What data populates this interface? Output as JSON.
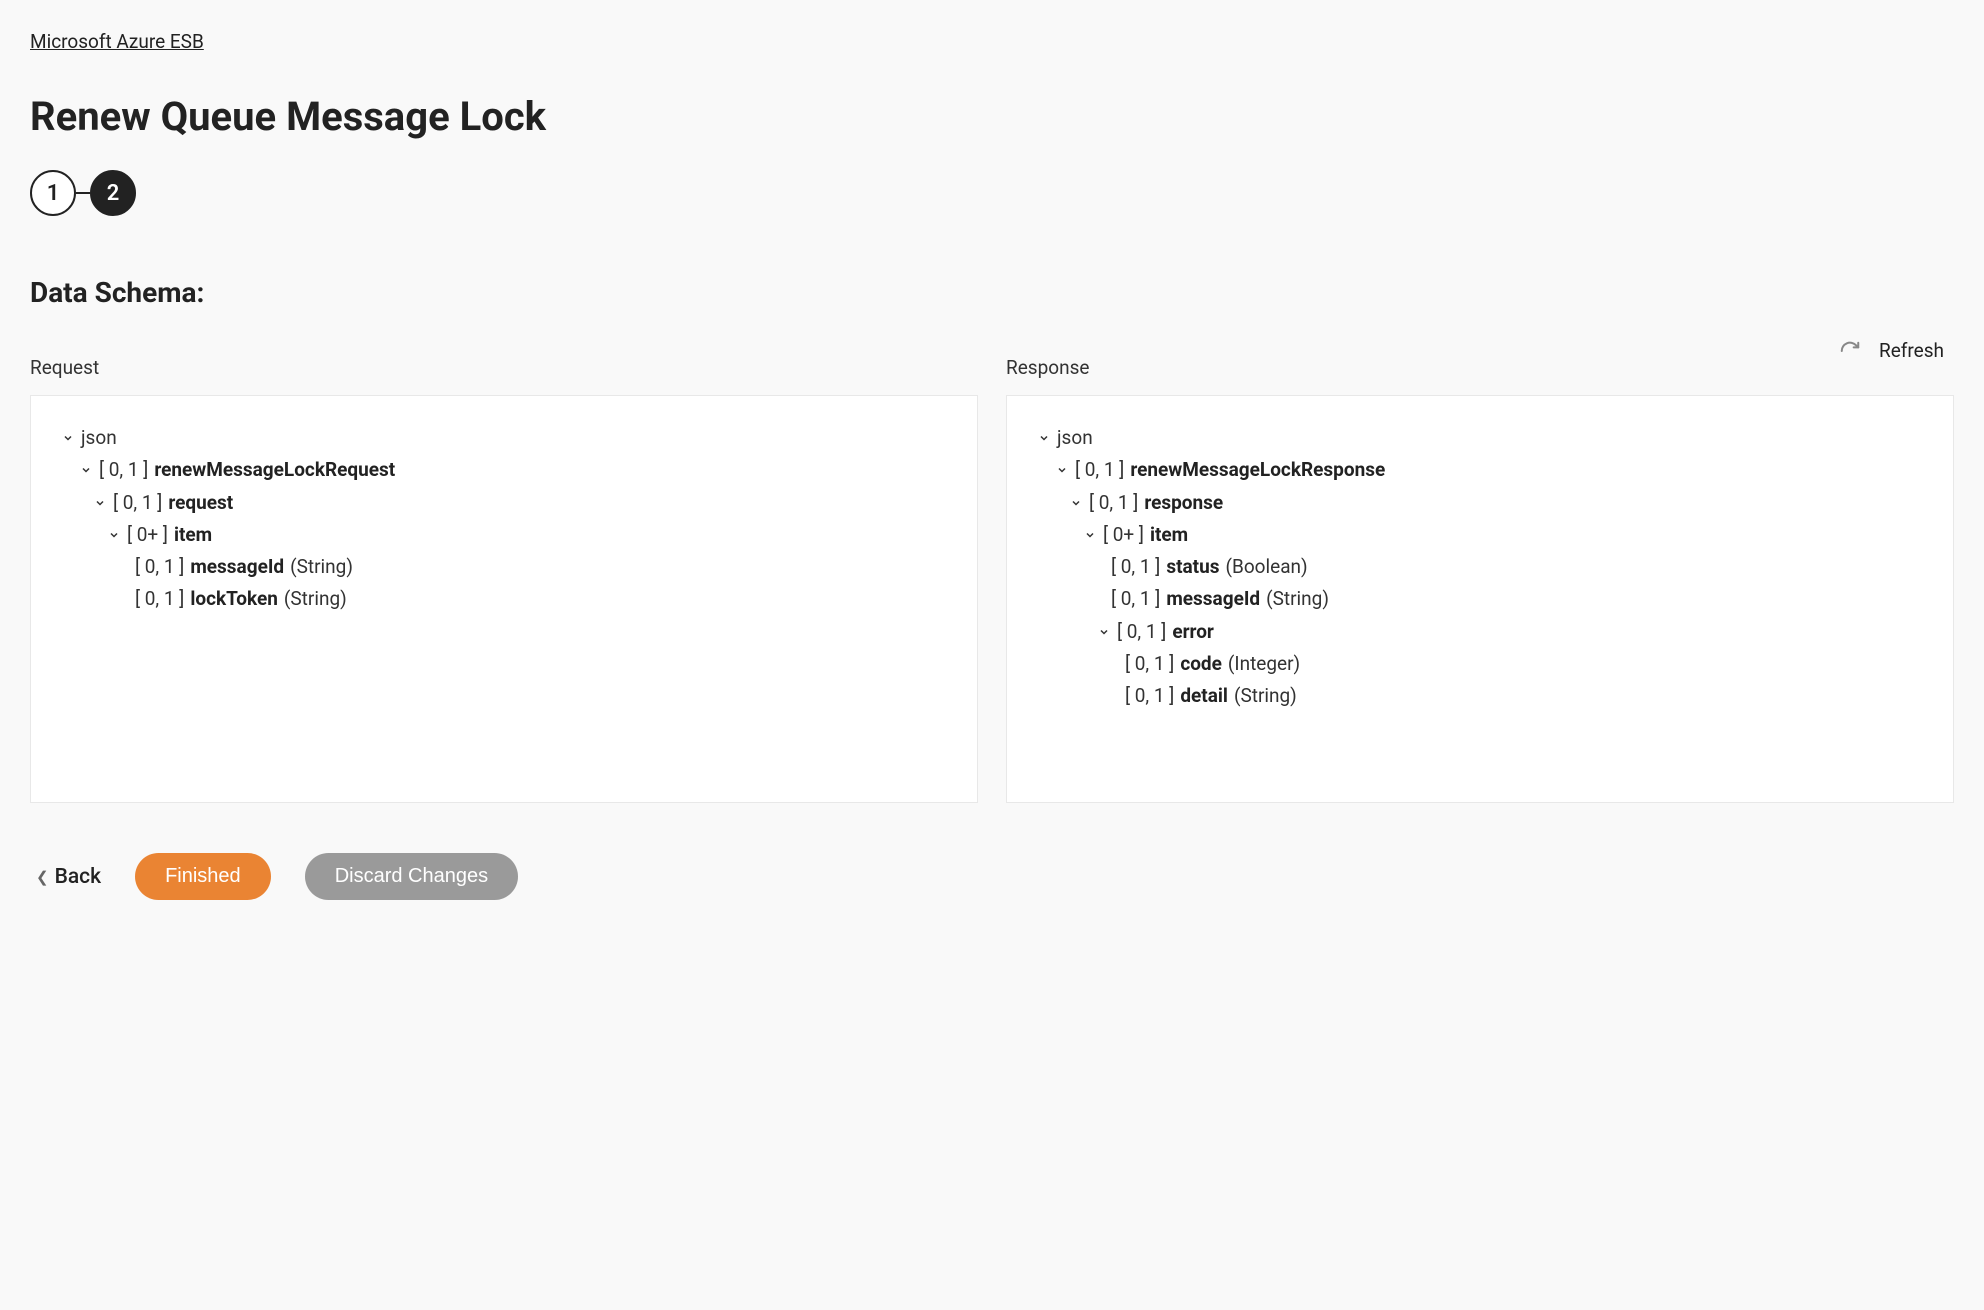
{
  "breadcrumb": "Microsoft Azure ESB",
  "title": "Renew Queue Message Lock",
  "stepper": {
    "step1": "1",
    "step2": "2"
  },
  "section": "Data Schema:",
  "refresh": "Refresh",
  "panel_labels": {
    "request": "Request",
    "response": "Response"
  },
  "request_tree": {
    "root": "json",
    "n1_card": "[ 0, 1 ]",
    "n1_name": "renewMessageLockRequest",
    "n2_card": "[ 0, 1 ]",
    "n2_name": "request",
    "n3_card": "[ 0+ ]",
    "n3_name": "item",
    "n4_card": "[ 0, 1 ]",
    "n4_name": "messageId",
    "n4_type": "(String)",
    "n5_card": "[ 0, 1 ]",
    "n5_name": "lockToken",
    "n5_type": "(String)"
  },
  "response_tree": {
    "root": "json",
    "n1_card": "[ 0, 1 ]",
    "n1_name": "renewMessageLockResponse",
    "n2_card": "[ 0, 1 ]",
    "n2_name": "response",
    "n3_card": "[ 0+ ]",
    "n3_name": "item",
    "n4_card": "[ 0, 1 ]",
    "n4_name": "status",
    "n4_type": "(Boolean)",
    "n5_card": "[ 0, 1 ]",
    "n5_name": "messageId",
    "n5_type": "(String)",
    "n6_card": "[ 0, 1 ]",
    "n6_name": "error",
    "n7_card": "[ 0, 1 ]",
    "n7_name": "code",
    "n7_type": "(Integer)",
    "n8_card": "[ 0, 1 ]",
    "n8_name": "detail",
    "n8_type": "(String)"
  },
  "actions": {
    "back": "Back",
    "finished": "Finished",
    "discard": "Discard Changes"
  }
}
